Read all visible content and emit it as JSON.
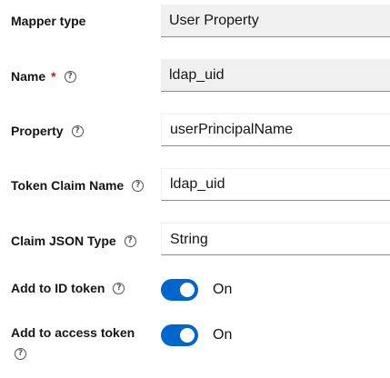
{
  "form": {
    "mapper_type": {
      "label": "Mapper type",
      "value": "User Property"
    },
    "name": {
      "label": "Name",
      "required_mark": "*",
      "value": "ldap_uid"
    },
    "property": {
      "label": "Property",
      "value": "userPrincipalName"
    },
    "token_claim_name": {
      "label": "Token Claim Name",
      "value": "ldap_uid"
    },
    "claim_json_type": {
      "label": "Claim JSON Type",
      "value": "String"
    },
    "add_to_id_token": {
      "label": "Add to ID token",
      "state_label": "On",
      "checked": true
    },
    "add_to_access_token": {
      "label": "Add to access token",
      "state_label": "On",
      "checked": true
    }
  },
  "icons": {
    "help": "question-circle-icon"
  },
  "colors": {
    "switch_on": "#0066cc",
    "required": "#c9190b",
    "readonly_bg": "#f0f0f0"
  }
}
